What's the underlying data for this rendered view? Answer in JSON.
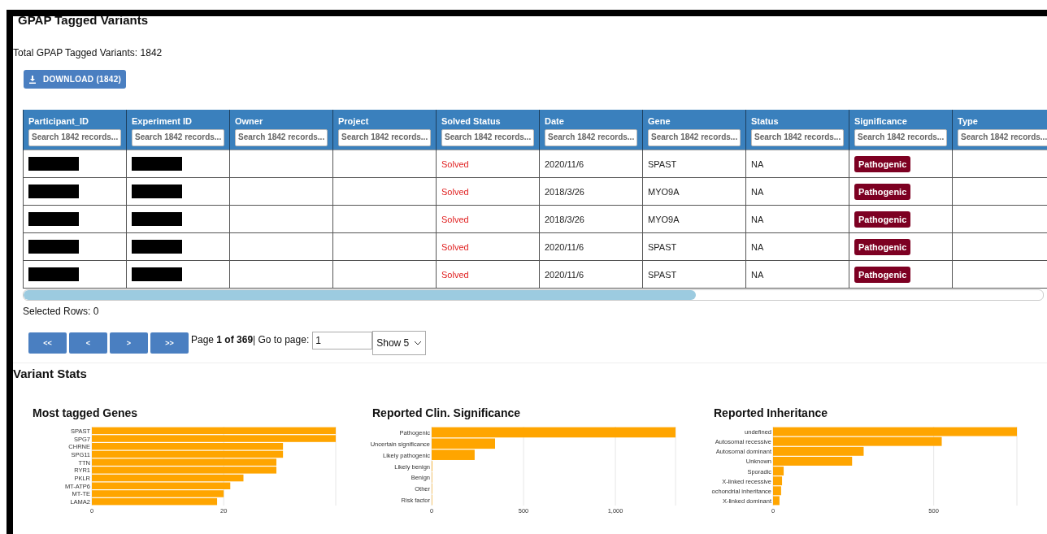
{
  "title": "GPAP Tagged Variants",
  "total": "Total GPAP Tagged Variants: 1842",
  "download_button": "DOWNLOAD (1842)",
  "table": {
    "columns": [
      {
        "label": "Participant_ID",
        "placeholder": "Search 1842 records..."
      },
      {
        "label": "Experiment ID",
        "placeholder": "Search 1842 records..."
      },
      {
        "label": "Owner",
        "placeholder": "Search 1842 records..."
      },
      {
        "label": "Project",
        "placeholder": "Search 1842 records..."
      },
      {
        "label": "Solved Status",
        "placeholder": "Search 1842 records..."
      },
      {
        "label": "Date",
        "placeholder": "Search 1842 records..."
      },
      {
        "label": "Gene",
        "placeholder": "Search 1842 records..."
      },
      {
        "label": "Status",
        "placeholder": "Search 1842 records..."
      },
      {
        "label": "Significance",
        "placeholder": "Search 1842 records..."
      },
      {
        "label": "Type",
        "placeholder": "Search 1842 records..."
      }
    ],
    "rows": [
      {
        "redacted": true,
        "solved_status": "Solved",
        "date": "2020/11/6",
        "gene": "SPAST",
        "status": "NA",
        "significance": "Pathogenic"
      },
      {
        "redacted": true,
        "solved_status": "Solved",
        "date": "2018/3/26",
        "gene": "MYO9A",
        "status": "NA",
        "significance": "Pathogenic"
      },
      {
        "redacted": true,
        "solved_status": "Solved",
        "date": "2018/3/26",
        "gene": "MYO9A",
        "status": "NA",
        "significance": "Pathogenic"
      },
      {
        "redacted": true,
        "solved_status": "Solved",
        "date": "2020/11/6",
        "gene": "SPAST",
        "status": "NA",
        "significance": "Pathogenic"
      },
      {
        "redacted": true,
        "solved_status": "Solved",
        "date": "2020/11/6",
        "gene": "SPAST",
        "status": "NA",
        "significance": "Pathogenic"
      }
    ]
  },
  "selected_rows": "Selected Rows: 0",
  "pagination": {
    "buttons": [
      "<<",
      "<",
      ">",
      ">>"
    ],
    "page_text": "Page **1 of 369**| Go to page:",
    "page_input": "1",
    "show": "Show 5"
  },
  "stats_title": "Variant Stats",
  "charts": [
    {
      "chart_data": {
        "type": "bar",
        "orientation": "horizontal",
        "title": "Most tagged Genes",
        "categories": [
          "SPAST",
          "SPG7",
          "CHRNE",
          "SPG11",
          "TTN",
          "RYR1",
          "PKLR",
          "MT-ATP6",
          "MT-TE",
          "LAMA2"
        ],
        "series": [
          {
            "color": "#ffa500",
            "values": [
              37,
              37,
              29,
              29,
              28,
              28,
              23,
              21,
              20,
              19
            ]
          }
        ],
        "xlim": [
          0,
          37
        ],
        "xticks": [
          0,
          20
        ]
      }
    },
    {
      "chart_data": {
        "type": "bar",
        "orientation": "horizontal",
        "title": "Reported Clin. Significance",
        "categories": [
          "Pathogenic",
          "Uncertain significance",
          "Likely pathogenic",
          "Likely benign",
          "Benign",
          "Other",
          "Risk factor"
        ],
        "series": [
          {
            "color": "#ffa500",
            "values": [
              1327,
              345,
              234,
              3,
              1,
              1,
              1
            ]
          }
        ],
        "xlim": [
          0,
          1327
        ],
        "xticks": [
          0,
          500,
          {
            "value": 1000,
            "label": "1,000"
          }
        ]
      }
    },
    {
      "chart_data": {
        "type": "bar",
        "orientation": "horizontal",
        "title": "Reported Inheritance",
        "categories": [
          "undefined",
          "Autosomal recessive",
          "Autosomal dominant",
          "Unknown",
          "Sporadic",
          "X-linked recessive",
          "ochondrial inheritance",
          "X-linked dominant"
        ],
        "series": [
          {
            "color": "#ffa500",
            "values": [
              759,
              525,
              282,
              246,
              33,
              28,
              25,
              20
            ]
          }
        ],
        "xlim": [
          0,
          759
        ],
        "xticks": [
          0,
          500
        ]
      }
    }
  ]
}
